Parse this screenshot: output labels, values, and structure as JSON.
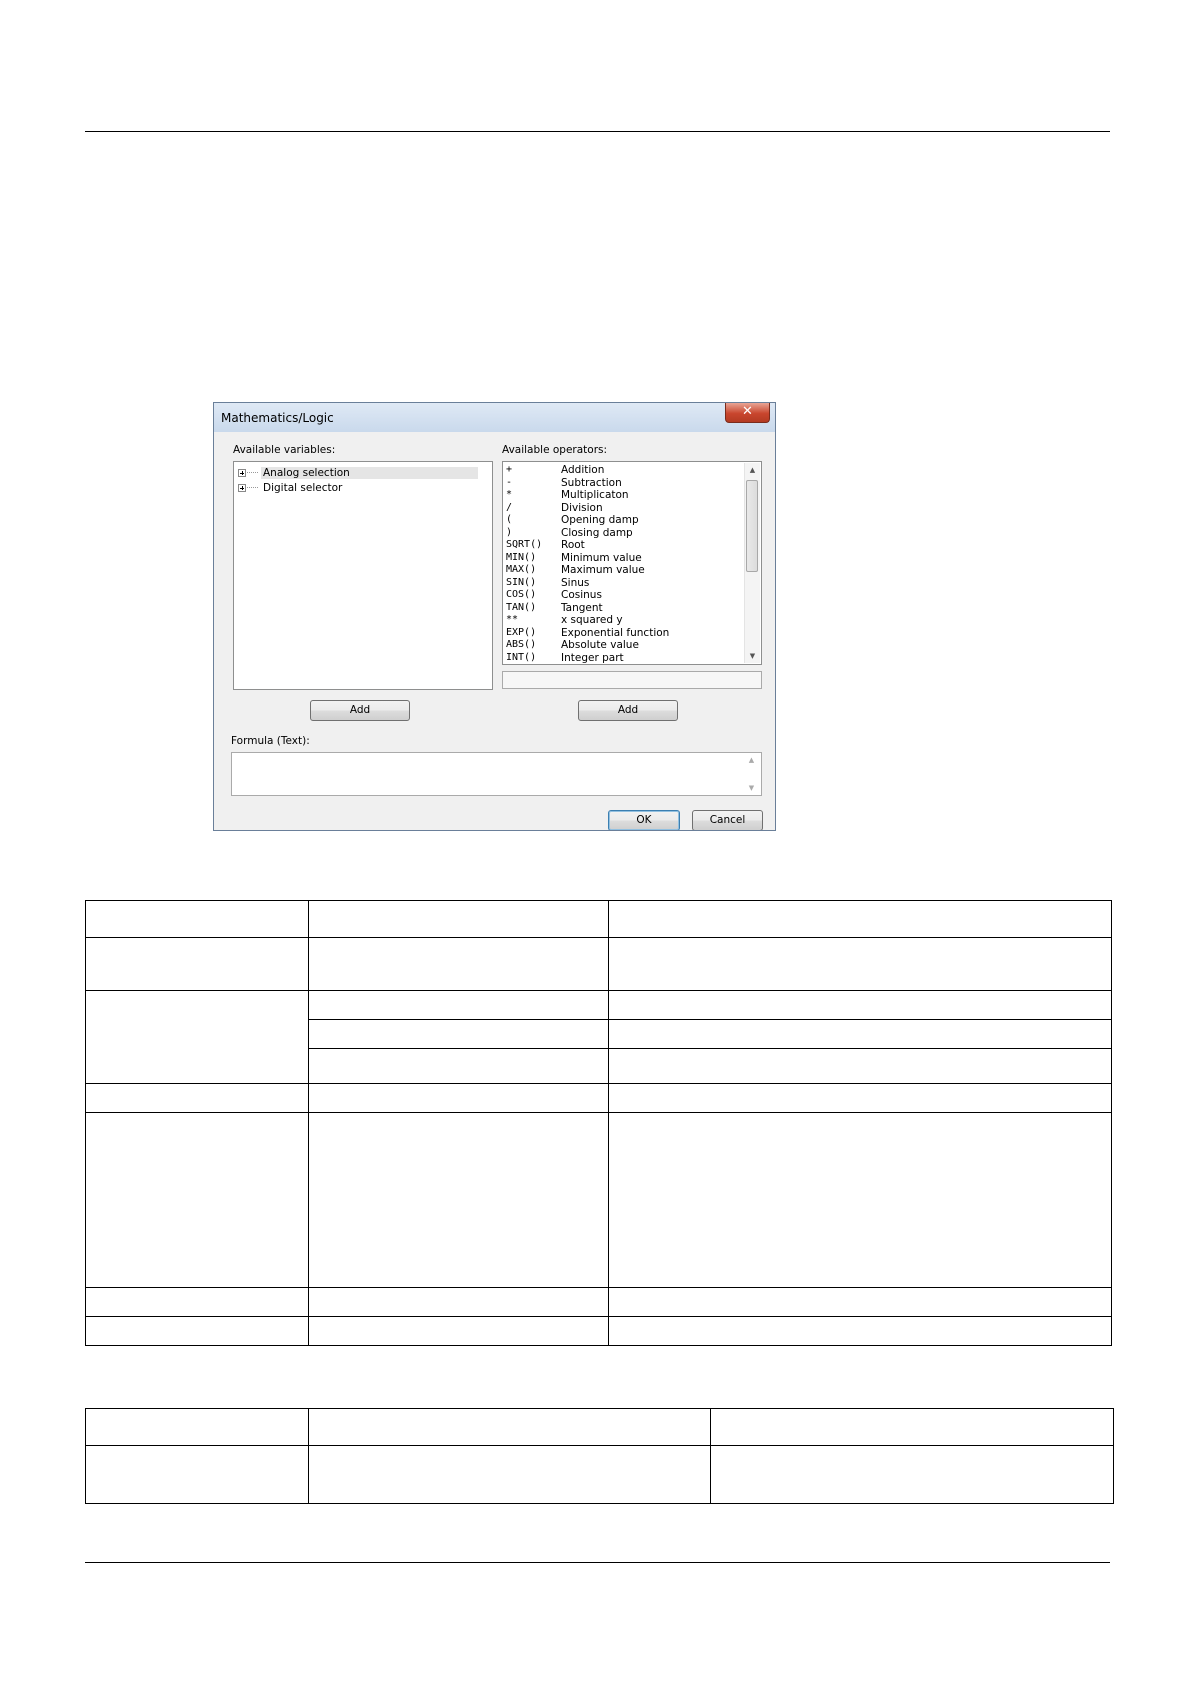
{
  "dialog": {
    "title": "Mathematics/Logic",
    "close_glyph": "✕",
    "variables_label": "Available variables:",
    "operators_label": "Available operators:",
    "variables": [
      "Analog selection",
      "Digital selector"
    ],
    "operators": [
      {
        "symbol": "+",
        "description": "Addition"
      },
      {
        "symbol": "-",
        "description": "Subtraction"
      },
      {
        "symbol": "*",
        "description": "Multiplicaton"
      },
      {
        "symbol": "/",
        "description": "Division"
      },
      {
        "symbol": "(",
        "description": "Opening damp"
      },
      {
        "symbol": ")",
        "description": "Closing damp"
      },
      {
        "symbol": "SQRT()",
        "description": "Root"
      },
      {
        "symbol": "MIN()",
        "description": "Minimum value"
      },
      {
        "symbol": "MAX()",
        "description": "Maximum value"
      },
      {
        "symbol": "SIN()",
        "description": "Sinus"
      },
      {
        "symbol": "COS()",
        "description": "Cosinus"
      },
      {
        "symbol": "TAN()",
        "description": "Tangent"
      },
      {
        "symbol": "**",
        "description": "x squared y"
      },
      {
        "symbol": "EXP()",
        "description": "Exponential function"
      },
      {
        "symbol": "ABS()",
        "description": "Absolute value"
      },
      {
        "symbol": "INT()",
        "description": "Integer part"
      }
    ],
    "add_variables_label": "Add",
    "add_operators_label": "Add",
    "formula_label": "Formula (Text):",
    "formula_value": "",
    "ok_label": "OK",
    "cancel_label": "Cancel"
  }
}
